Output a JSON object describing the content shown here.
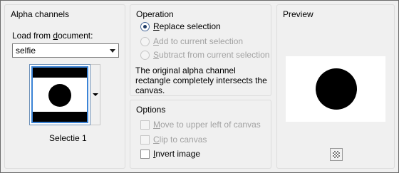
{
  "alpha_channels": {
    "title": "Alpha channels",
    "load_from_label": "Load from document:",
    "load_from_accel": "d",
    "document_select_value": "selfie",
    "thumbnail_caption": "Selectie 1"
  },
  "operation": {
    "title": "Operation",
    "replace": {
      "label": "Replace selection",
      "accel": "R",
      "rest": "eplace selection",
      "checked": true,
      "enabled": true
    },
    "add": {
      "label": "Add to current selection",
      "accel": "A",
      "rest": "dd to current selection",
      "checked": false,
      "enabled": false
    },
    "subtract": {
      "label": "Subtract from current selection",
      "accel": "S",
      "rest": "ubtract from current selection",
      "checked": false,
      "enabled": false
    },
    "description_lines": [
      "The original alpha channel",
      "rectangle completely intersects the",
      "canvas."
    ]
  },
  "options": {
    "title": "Options",
    "move": {
      "label": "Move to upper left of canvas",
      "accel": "M",
      "rest": "ove to upper left of canvas",
      "checked": false,
      "enabled": false
    },
    "clip": {
      "label": "Clip to canvas",
      "accel": "C",
      "rest": "lip to canvas",
      "checked": false,
      "enabled": false
    },
    "invert": {
      "label": "Invert image",
      "accel": "I",
      "rest": "nvert image",
      "checked": false,
      "enabled": true
    }
  },
  "preview": {
    "title": "Preview",
    "transparency_icon": "checkerboard-icon"
  },
  "colors": {
    "dialog_bg": "#f0f0f0",
    "selection_blue": "#3c84d6",
    "disabled_text": "#a2a2a2"
  }
}
